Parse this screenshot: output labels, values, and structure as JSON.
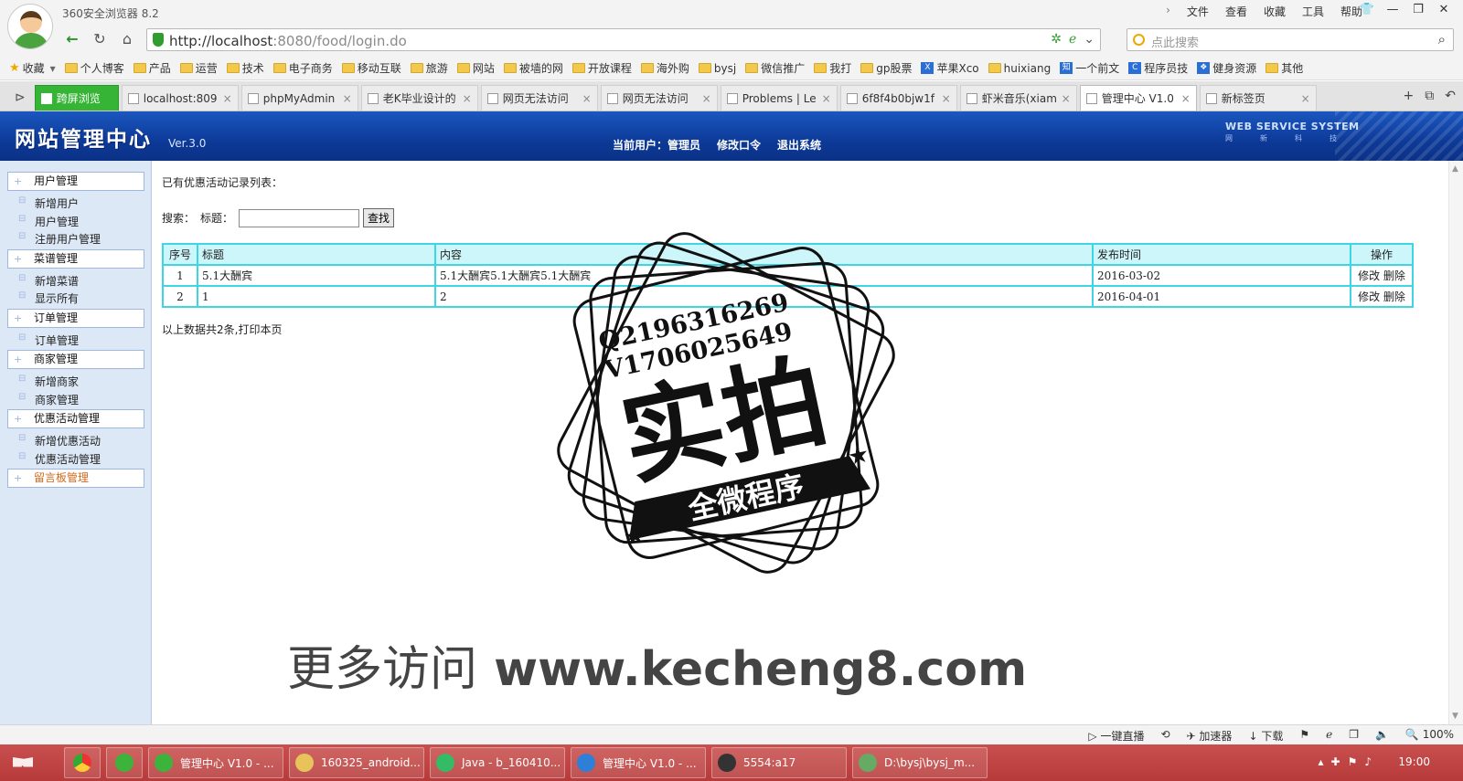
{
  "browser": {
    "app_title": "360安全浏览器 8.2",
    "menu": [
      "文件",
      "查看",
      "收藏",
      "工具",
      "帮助"
    ],
    "url_host": "http://localhost",
    "url_path": ":8080/food/login.do",
    "search_placeholder": "点此搜索",
    "bookmarks": [
      "收藏",
      "个人博客",
      "产品",
      "运营",
      "技术",
      "电子商务",
      "移动互联",
      "旅游",
      "网站",
      "被墙的网",
      "开放课程",
      "海外购",
      "bysj",
      "微信推广",
      "我打",
      "gp股票",
      "苹果Xco",
      "huixiang",
      "一个前文",
      "程序员技",
      "健身资源",
      "其他"
    ],
    "tabs": [
      {
        "label": "跨屏浏览",
        "style": "green",
        "closable": false
      },
      {
        "label": "localhost:809",
        "style": "normal",
        "closable": true
      },
      {
        "label": "phpMyAdmin",
        "style": "normal",
        "closable": true
      },
      {
        "label": "老K毕业设计的",
        "style": "normal",
        "closable": true
      },
      {
        "label": "网页无法访问",
        "style": "normal",
        "closable": true
      },
      {
        "label": "网页无法访问",
        "style": "normal",
        "closable": true
      },
      {
        "label": "Problems | Le",
        "style": "normal",
        "closable": true
      },
      {
        "label": "6f8f4b0bjw1f",
        "style": "normal",
        "closable": true
      },
      {
        "label": "虾米音乐(xiam",
        "style": "normal",
        "closable": true
      },
      {
        "label": "管理中心 V1.0",
        "style": "active",
        "closable": true
      },
      {
        "label": "新标签页",
        "style": "normal",
        "closable": true
      }
    ]
  },
  "header": {
    "site_title": "网站管理中心",
    "version": "Ver.3.0",
    "current_user_label": "当前用户：",
    "user_role": "管理员",
    "change_password": "修改口令",
    "logout": "退出系统",
    "brand_text": "WEB SERVICE SYSTEM",
    "brand_sub": "网新科技"
  },
  "sidebar": {
    "groups": [
      {
        "title": "用户管理",
        "items": [
          "新增用户",
          "用户管理",
          "注册用户管理"
        ]
      },
      {
        "title": "菜谱管理",
        "items": [
          "新增菜谱",
          "显示所有"
        ]
      },
      {
        "title": "订单管理",
        "items": [
          "订单管理"
        ]
      },
      {
        "title": "商家管理",
        "items": [
          "新增商家",
          "商家管理"
        ]
      },
      {
        "title": "优惠活动管理",
        "items": [
          "新增优惠活动",
          "优惠活动管理"
        ]
      },
      {
        "title": "留言板管理",
        "items": []
      }
    ]
  },
  "main": {
    "list_title": "已有优惠活动记录列表：",
    "search_label": "搜索：",
    "title_label": "标题：",
    "title_input_value": "",
    "find_button": "查找",
    "table": {
      "headers": [
        "序号",
        "标题",
        "内容",
        "发布时间",
        "操作"
      ],
      "rows": [
        {
          "no": "1",
          "title": "5.1大酬宾",
          "content": "5.1大酬宾5.1大酬宾5.1大酬宾",
          "time": "2016-03-02",
          "edit": "修改",
          "delete": "删除"
        },
        {
          "no": "2",
          "title": "1",
          "content": "2",
          "time": "2016-04-01",
          "edit": "修改",
          "delete": "删除"
        }
      ]
    },
    "footer_prefix": "以上数据共2条,",
    "print_link": "打印本页"
  },
  "watermark": {
    "qq": "Q2196316269",
    "v": "V1706025649",
    "big": "实拍",
    "ribbon": "全微程序",
    "promo_cn": "更多访问",
    "promo_url": "www.kecheng8.com"
  },
  "statusbar": [
    "一键直播",
    "加速器",
    "下载",
    "100%"
  ],
  "taskbar": {
    "tasks": [
      "管理中心 V1.0 - ...",
      "160325_android...",
      "Java - b_160410...",
      "管理中心 V1.0 - ...",
      "5554:a17",
      "D:\\bysj\\bysj_m..."
    ],
    "clock": "19:00"
  },
  "colors": {
    "header_blue": "#0d3a98",
    "table_border": "#3ed6e4",
    "table_header_bg": "#ccf6fa",
    "sidebar_bg": "#dde8f7",
    "taskbar_red": "#b63a3a"
  }
}
